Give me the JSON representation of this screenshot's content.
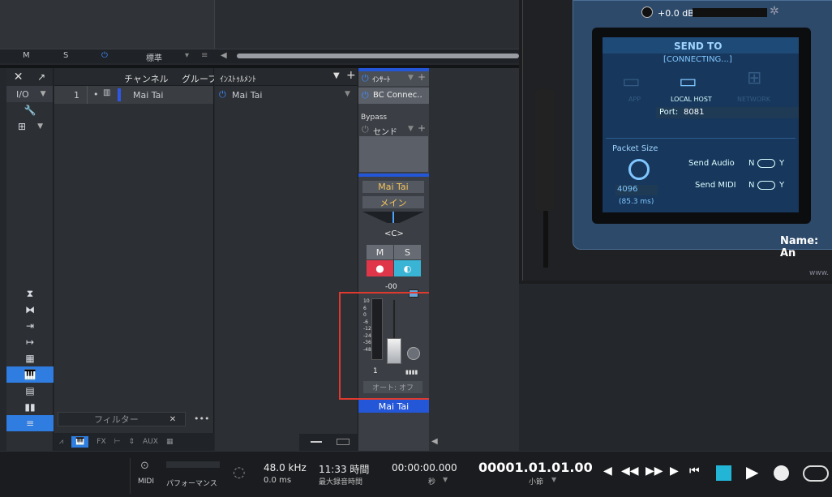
{
  "top": {
    "m": "M",
    "s": "S",
    "preset": "標準"
  },
  "channels": {
    "header_channel": "チャンネル",
    "header_group": "グループ",
    "row_num": "1",
    "row_name": "Mai Tai",
    "filter_placeholder": "フィルター",
    "more": "•••"
  },
  "leftstrip": {
    "io": "I/O"
  },
  "instrument": {
    "header": "ｲﾝｽﾄｩﾙﾒﾝﾄ",
    "item": "Mai Tai"
  },
  "mixer": {
    "insert": "ｲﾝｻｰﾄ",
    "insert_item": "BC Connec..",
    "bypass": "Bypass",
    "send": "センド",
    "channel_name": "Mai Tai",
    "output": "メイン",
    "pan": "<C>",
    "mute": "M",
    "solo": "S",
    "level": "-00",
    "scale": [
      "10",
      "6",
      "0",
      "-6",
      "-12",
      "-24",
      "-36",
      "-48"
    ],
    "number": "1",
    "auto": "オート: オフ",
    "footer_name": "Mai Tai"
  },
  "bottom_tabs": [
    "FX",
    "AUX"
  ],
  "plugin": {
    "gain": "+0.0 dB",
    "send_to": "SEND TO",
    "status": "[CONNECTING...]",
    "app": "APP",
    "local_host": "LOCAL HOST",
    "network": "NETWORK",
    "port_label": "Port:",
    "port": "8081",
    "packet_size": "Packet Size",
    "send_audio": "Send Audio",
    "send_midi": "Send MIDI",
    "n": "N",
    "y": "Y",
    "packet_value": "4096",
    "packet_ms": "(85.3 ms)",
    "name_label": "Name: An",
    "www": "www."
  },
  "status": {
    "midi": "MIDI",
    "performance": "パフォーマンス",
    "sample_rate": "48.0 kHz",
    "latency": "0.0 ms",
    "record_time": "11:33 時間",
    "record_label": "最大録音時間",
    "time": "00:00:00.000",
    "time_unit": "秒",
    "bars": "00001.01.01.00",
    "bars_unit": "小節"
  },
  "colors": {
    "accent": "#2f7de1",
    "highlight": "#e03a2f",
    "cyan": "#22b5d6"
  }
}
